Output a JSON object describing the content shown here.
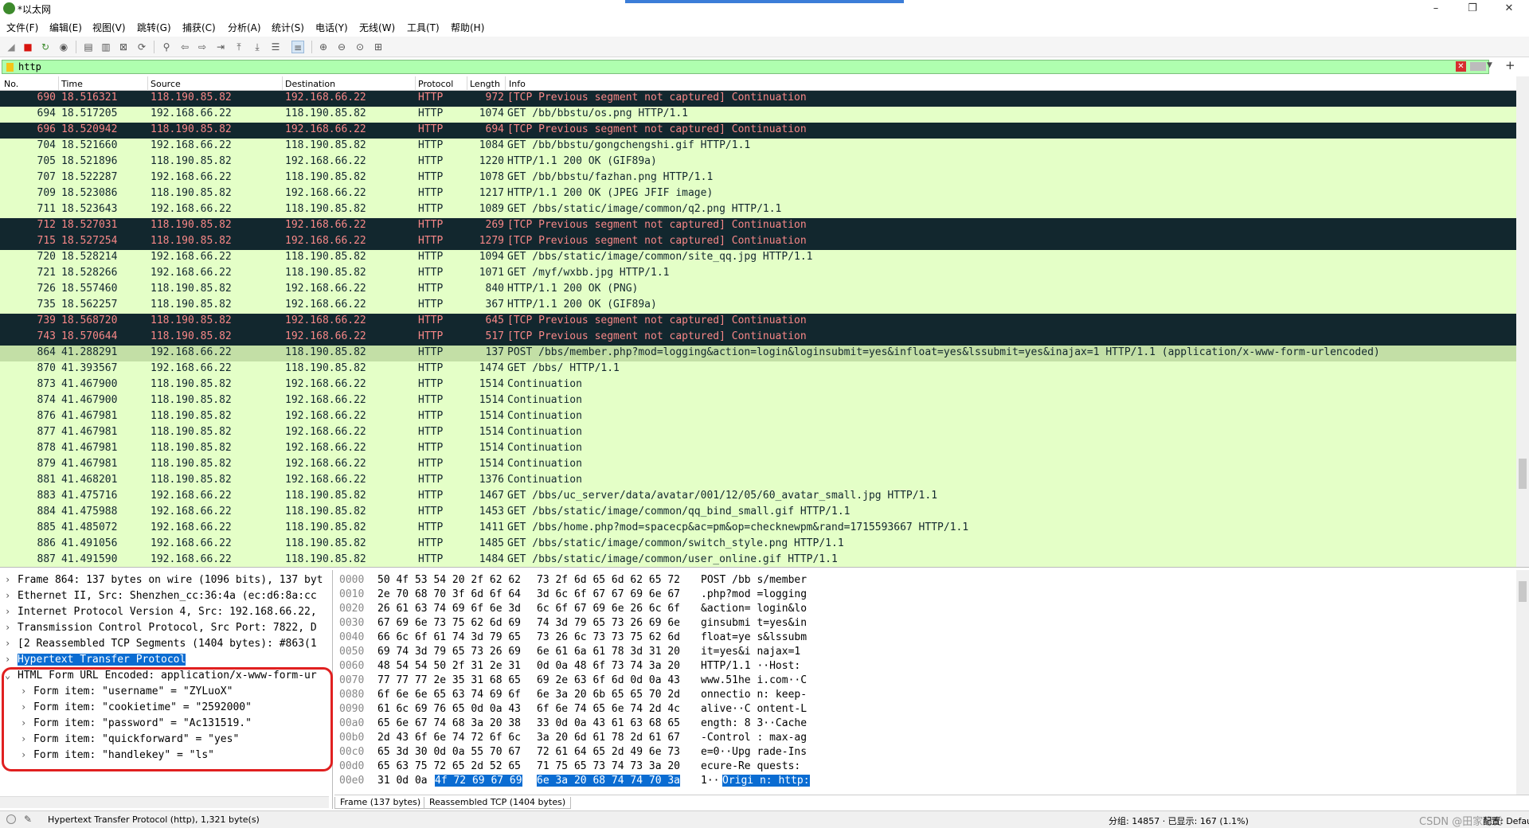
{
  "window": {
    "title": "*以太网",
    "minimize": "–",
    "maximize": "❐",
    "close": "✕"
  },
  "menu": [
    "文件(F)",
    "编辑(E)",
    "视图(V)",
    "跳转(G)",
    "捕获(C)",
    "分析(A)",
    "统计(S)",
    "电话(Y)",
    "无线(W)",
    "工具(T)",
    "帮助(H)"
  ],
  "toolbar": {
    "icons": [
      "shark-fin-start-icon",
      "stop-capture-icon",
      "restart-capture-icon",
      "capture-options-icon",
      "open-file-icon",
      "save-file-icon",
      "close-file-icon",
      "reload-file-icon",
      "find-packet-icon",
      "go-back-icon",
      "go-forward-icon",
      "go-to-packet-icon",
      "go-first-icon",
      "go-last-icon",
      "auto-scroll-icon",
      "colorize-icon",
      "zoom-in-icon",
      "zoom-out-icon",
      "normal-size-icon",
      "resize-columns-icon"
    ]
  },
  "filter": {
    "value": "http"
  },
  "columns": [
    "No.",
    "Time",
    "Source",
    "Destination",
    "Protocol",
    "Length",
    "Info"
  ],
  "packets": [
    {
      "no": "690",
      "time": "18.516321",
      "src": "118.190.85.82",
      "dst": "192.168.66.22",
      "proto": "HTTP",
      "len": "972",
      "info": "[TCP Previous segment not captured] Continuation",
      "style": "dark"
    },
    {
      "no": "694",
      "time": "18.517205",
      "src": "192.168.66.22",
      "dst": "118.190.85.82",
      "proto": "HTTP",
      "len": "1074",
      "info": "GET /bb/bbstu/os.png HTTP/1.1",
      "style": "normal"
    },
    {
      "no": "696",
      "time": "18.520942",
      "src": "118.190.85.82",
      "dst": "192.168.66.22",
      "proto": "HTTP",
      "len": "694",
      "info": "[TCP Previous segment not captured] Continuation",
      "style": "dark"
    },
    {
      "no": "704",
      "time": "18.521660",
      "src": "192.168.66.22",
      "dst": "118.190.85.82",
      "proto": "HTTP",
      "len": "1084",
      "info": "GET /bb/bbstu/gongchengshi.gif HTTP/1.1",
      "style": "normal"
    },
    {
      "no": "705",
      "time": "18.521896",
      "src": "118.190.85.82",
      "dst": "192.168.66.22",
      "proto": "HTTP",
      "len": "1220",
      "info": "HTTP/1.1 200 OK  (GIF89a)",
      "style": "normal"
    },
    {
      "no": "707",
      "time": "18.522287",
      "src": "192.168.66.22",
      "dst": "118.190.85.82",
      "proto": "HTTP",
      "len": "1078",
      "info": "GET /bb/bbstu/fazhan.png HTTP/1.1",
      "style": "normal"
    },
    {
      "no": "709",
      "time": "18.523086",
      "src": "118.190.85.82",
      "dst": "192.168.66.22",
      "proto": "HTTP",
      "len": "1217",
      "info": "HTTP/1.1 200 OK  (JPEG JFIF image)",
      "style": "normal"
    },
    {
      "no": "711",
      "time": "18.523643",
      "src": "192.168.66.22",
      "dst": "118.190.85.82",
      "proto": "HTTP",
      "len": "1089",
      "info": "GET /bbs/static/image/common/q2.png HTTP/1.1",
      "style": "normal"
    },
    {
      "no": "712",
      "time": "18.527031",
      "src": "118.190.85.82",
      "dst": "192.168.66.22",
      "proto": "HTTP",
      "len": "269",
      "info": "[TCP Previous segment not captured] Continuation",
      "style": "dark"
    },
    {
      "no": "715",
      "time": "18.527254",
      "src": "118.190.85.82",
      "dst": "192.168.66.22",
      "proto": "HTTP",
      "len": "1279",
      "info": "[TCP Previous segment not captured] Continuation",
      "style": "dark"
    },
    {
      "no": "720",
      "time": "18.528214",
      "src": "192.168.66.22",
      "dst": "118.190.85.82",
      "proto": "HTTP",
      "len": "1094",
      "info": "GET /bbs/static/image/common/site_qq.jpg HTTP/1.1",
      "style": "normal"
    },
    {
      "no": "721",
      "time": "18.528266",
      "src": "192.168.66.22",
      "dst": "118.190.85.82",
      "proto": "HTTP",
      "len": "1071",
      "info": "GET /myf/wxbb.jpg HTTP/1.1",
      "style": "normal"
    },
    {
      "no": "726",
      "time": "18.557460",
      "src": "118.190.85.82",
      "dst": "192.168.66.22",
      "proto": "HTTP",
      "len": "840",
      "info": "HTTP/1.1 200 OK  (PNG)",
      "style": "normal"
    },
    {
      "no": "735",
      "time": "18.562257",
      "src": "118.190.85.82",
      "dst": "192.168.66.22",
      "proto": "HTTP",
      "len": "367",
      "info": "HTTP/1.1 200 OK  (GIF89a)",
      "style": "normal"
    },
    {
      "no": "739",
      "time": "18.568720",
      "src": "118.190.85.82",
      "dst": "192.168.66.22",
      "proto": "HTTP",
      "len": "645",
      "info": "[TCP Previous segment not captured] Continuation",
      "style": "dark"
    },
    {
      "no": "743",
      "time": "18.570644",
      "src": "118.190.85.82",
      "dst": "192.168.66.22",
      "proto": "HTTP",
      "len": "517",
      "info": "[TCP Previous segment not captured] Continuation",
      "style": "dark"
    },
    {
      "no": "864",
      "time": "41.288291",
      "src": "192.168.66.22",
      "dst": "118.190.85.82",
      "proto": "HTTP",
      "len": "137",
      "info": "POST /bbs/member.php?mod=logging&action=login&loginsubmit=yes&infloat=yes&lssubmit=yes&inajax=1 HTTP/1.1  (application/x-www-form-urlencoded)",
      "style": "sel"
    },
    {
      "no": "870",
      "time": "41.393567",
      "src": "192.168.66.22",
      "dst": "118.190.85.82",
      "proto": "HTTP",
      "len": "1474",
      "info": "GET /bbs/ HTTP/1.1",
      "style": "normal"
    },
    {
      "no": "873",
      "time": "41.467900",
      "src": "118.190.85.82",
      "dst": "192.168.66.22",
      "proto": "HTTP",
      "len": "1514",
      "info": "Continuation",
      "style": "normal"
    },
    {
      "no": "874",
      "time": "41.467900",
      "src": "118.190.85.82",
      "dst": "192.168.66.22",
      "proto": "HTTP",
      "len": "1514",
      "info": "Continuation",
      "style": "normal"
    },
    {
      "no": "876",
      "time": "41.467981",
      "src": "118.190.85.82",
      "dst": "192.168.66.22",
      "proto": "HTTP",
      "len": "1514",
      "info": "Continuation",
      "style": "normal"
    },
    {
      "no": "877",
      "time": "41.467981",
      "src": "118.190.85.82",
      "dst": "192.168.66.22",
      "proto": "HTTP",
      "len": "1514",
      "info": "Continuation",
      "style": "normal"
    },
    {
      "no": "878",
      "time": "41.467981",
      "src": "118.190.85.82",
      "dst": "192.168.66.22",
      "proto": "HTTP",
      "len": "1514",
      "info": "Continuation",
      "style": "normal"
    },
    {
      "no": "879",
      "time": "41.467981",
      "src": "118.190.85.82",
      "dst": "192.168.66.22",
      "proto": "HTTP",
      "len": "1514",
      "info": "Continuation",
      "style": "normal"
    },
    {
      "no": "881",
      "time": "41.468201",
      "src": "118.190.85.82",
      "dst": "192.168.66.22",
      "proto": "HTTP",
      "len": "1376",
      "info": "Continuation",
      "style": "normal"
    },
    {
      "no": "883",
      "time": "41.475716",
      "src": "192.168.66.22",
      "dst": "118.190.85.82",
      "proto": "HTTP",
      "len": "1467",
      "info": "GET /bbs/uc_server/data/avatar/001/12/05/60_avatar_small.jpg HTTP/1.1",
      "style": "normal"
    },
    {
      "no": "884",
      "time": "41.475988",
      "src": "192.168.66.22",
      "dst": "118.190.85.82",
      "proto": "HTTP",
      "len": "1453",
      "info": "GET /bbs/static/image/common/qq_bind_small.gif HTTP/1.1",
      "style": "normal"
    },
    {
      "no": "885",
      "time": "41.485072",
      "src": "192.168.66.22",
      "dst": "118.190.85.82",
      "proto": "HTTP",
      "len": "1411",
      "info": "GET /bbs/home.php?mod=spacecp&ac=pm&op=checknewpm&rand=1715593667 HTTP/1.1",
      "style": "normal"
    },
    {
      "no": "886",
      "time": "41.491056",
      "src": "192.168.66.22",
      "dst": "118.190.85.82",
      "proto": "HTTP",
      "len": "1485",
      "info": "GET /bbs/static/image/common/switch_style.png HTTP/1.1",
      "style": "normal"
    },
    {
      "no": "887",
      "time": "41.491590",
      "src": "192.168.66.22",
      "dst": "118.190.85.82",
      "proto": "HTTP",
      "len": "1484",
      "info": "GET /bbs/static/image/common/user_online.gif HTTP/1.1",
      "style": "normal"
    }
  ],
  "tree": [
    {
      "exp": "›",
      "text": "Frame 864: 137 bytes on wire (1096 bits), 137 byt",
      "indent": 0,
      "hl": false
    },
    {
      "exp": "›",
      "text": "Ethernet II, Src: Shenzhen_cc:36:4a (ec:d6:8a:cc",
      "indent": 0,
      "hl": false
    },
    {
      "exp": "›",
      "text": "Internet Protocol Version 4, Src: 192.168.66.22,",
      "indent": 0,
      "hl": false
    },
    {
      "exp": "›",
      "text": "Transmission Control Protocol, Src Port: 7822, D",
      "indent": 0,
      "hl": false
    },
    {
      "exp": "›",
      "text": "[2 Reassembled TCP Segments (1404 bytes): #863(1",
      "indent": 0,
      "hl": false
    },
    {
      "exp": "›",
      "text": "Hypertext Transfer Protocol",
      "indent": 0,
      "hl": true
    },
    {
      "exp": "⌄",
      "text": "HTML Form URL Encoded: application/x-www-form-ur",
      "indent": 0,
      "hl": false
    },
    {
      "exp": "›",
      "text": "Form item: \"username\" = \"ZYLuoX\"",
      "indent": 1,
      "hl": false
    },
    {
      "exp": "›",
      "text": "Form item: \"cookietime\" = \"2592000\"",
      "indent": 1,
      "hl": false
    },
    {
      "exp": "›",
      "text": "Form item: \"password\" = \"Ac131519.\"",
      "indent": 1,
      "hl": false
    },
    {
      "exp": "›",
      "text": "Form item: \"quickforward\" = \"yes\"",
      "indent": 1,
      "hl": false
    },
    {
      "exp": "›",
      "text": "Form item: \"handlekey\" = \"ls\"",
      "indent": 1,
      "hl": false
    }
  ],
  "hex": [
    {
      "off": "0000",
      "a": "50 4f 53 54 20 2f 62 62",
      "b": "73 2f 6d 65 6d 62 65 72",
      "asc": "POST /bb s/member"
    },
    {
      "off": "0010",
      "a": "2e 70 68 70 3f 6d 6f 64",
      "b": "3d 6c 6f 67 67 69 6e 67",
      "asc": ".php?mod =logging"
    },
    {
      "off": "0020",
      "a": "26 61 63 74 69 6f 6e 3d",
      "b": "6c 6f 67 69 6e 26 6c 6f",
      "asc": "&action= login&lo"
    },
    {
      "off": "0030",
      "a": "67 69 6e 73 75 62 6d 69",
      "b": "74 3d 79 65 73 26 69 6e",
      "asc": "ginsubmi t=yes&in"
    },
    {
      "off": "0040",
      "a": "66 6c 6f 61 74 3d 79 65",
      "b": "73 26 6c 73 73 75 62 6d",
      "asc": "float=ye s&lssubm"
    },
    {
      "off": "0050",
      "a": "69 74 3d 79 65 73 26 69",
      "b": "6e 61 6a 61 78 3d 31 20",
      "asc": "it=yes&i najax=1 "
    },
    {
      "off": "0060",
      "a": "48 54 54 50 2f 31 2e 31",
      "b": "0d 0a 48 6f 73 74 3a 20",
      "asc": "HTTP/1.1 ··Host: "
    },
    {
      "off": "0070",
      "a": "77 77 77 2e 35 31 68 65",
      "b": "69 2e 63 6f 6d 0d 0a 43",
      "asc": "www.51he i.com··C"
    },
    {
      "off": "0080",
      "a": "6f 6e 6e 65 63 74 69 6f",
      "b": "6e 3a 20 6b 65 65 70 2d",
      "asc": "onnectio n: keep-"
    },
    {
      "off": "0090",
      "a": "61 6c 69 76 65 0d 0a 43",
      "b": "6f 6e 74 65 6e 74 2d 4c",
      "asc": "alive··C ontent-L"
    },
    {
      "off": "00a0",
      "a": "65 6e 67 74 68 3a 20 38",
      "b": "33 0d 0a 43 61 63 68 65",
      "asc": "ength: 8 3··Cache"
    },
    {
      "off": "00b0",
      "a": "2d 43 6f 6e 74 72 6f 6c",
      "b": "3a 20 6d 61 78 2d 61 67",
      "asc": "-Control : max-ag"
    },
    {
      "off": "00c0",
      "a": "65 3d 30 0d 0a 55 70 67",
      "b": "72 61 64 65 2d 49 6e 73",
      "asc": "e=0··Upg rade-Ins"
    },
    {
      "off": "00d0",
      "a": "65 63 75 72 65 2d 52 65",
      "b": "71 75 65 73 74 73 3a 20",
      "asc": "ecure-Re quests: "
    }
  ],
  "hex_last": {
    "off": "00e0",
    "a_plain": "31 0d 0a ",
    "a_sel": "4f 72 69 67 69",
    "b_sel": "6e 3a 20 68 74 74 70 3a",
    "asc_plain": "1··",
    "asc_sel": "Origi n: http:"
  },
  "byte_tabs": [
    "Frame (137 bytes)",
    "Reassembled TCP (1404 bytes)"
  ],
  "status": {
    "left": "Hypertext Transfer Protocol (http), 1,321 byte(s)",
    "packets": "分组: 14857 · 已显示: 167 (1.1%)",
    "profile": "配置: Default"
  },
  "watermark": "CSDN @田家缘分",
  "colors": {
    "filter_ok": "#afffaf",
    "row_bg": "#e4ffc7",
    "row_dark": "#12272e",
    "row_dark_text": "#f78787",
    "selected": "#c3dfa6",
    "highlight": "#0a6cd2",
    "annotation": "#e02020"
  }
}
